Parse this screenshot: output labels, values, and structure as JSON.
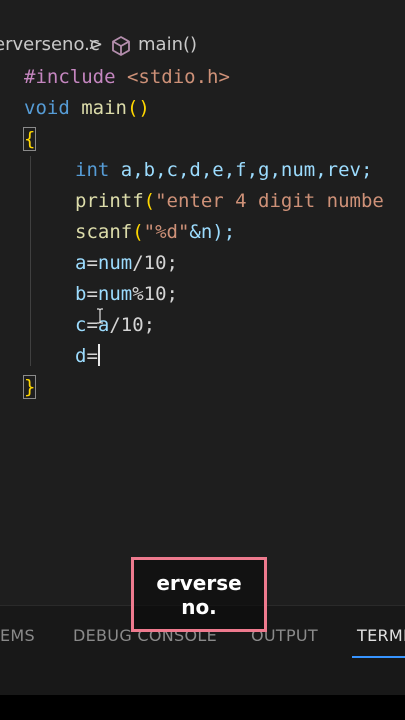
{
  "breadcrumb": {
    "file": "erverseno.c",
    "separator": ">",
    "function": "main()"
  },
  "code_lines": {
    "l1": {
      "directive": "#include",
      "header": "<stdio.h>"
    },
    "l2": {
      "type": "void",
      "name": "main",
      "parens": "()"
    },
    "l3": {
      "brace": "{"
    },
    "l4": {
      "type": "int",
      "vars": "a,b,c,d,e,f,g,num,rev;"
    },
    "l5": {
      "fn": "printf",
      "open": "(",
      "str": "\"enter 4 digit numbe"
    },
    "l6": {
      "fn": "scanf",
      "open": "(",
      "str": "\"%d\"",
      "rest": "&n);"
    },
    "l7": {
      "var": "a",
      "eq": "=",
      "rhs_var": "num",
      "rest": "/10;"
    },
    "l8": {
      "var": "b",
      "eq": "=",
      "rhs_var": "num",
      "rest": "%10;"
    },
    "l9": {
      "var": "c",
      "eq": "=",
      "rhs_var": "a",
      "rest": "/10;"
    },
    "l10": {
      "var": "d",
      "eq": "="
    },
    "l11": {
      "brace": "}"
    }
  },
  "panel_tabs": {
    "problems": "EMS",
    "debug_console": "DEBUG CONSOLE",
    "output": "OUTPUT",
    "terminal": "TERMI"
  },
  "caption": {
    "line1": "erverse",
    "line2": "no."
  },
  "colors": {
    "editor_bg": "#1e1e1e",
    "keyword": "#569cd6",
    "preprocessor": "#c586c0",
    "function": "#dcdcaa",
    "string": "#ce9178",
    "variable": "#9cdcfe",
    "brace": "#ffd700",
    "caption_border": "#ee7a8e",
    "active_tab_underline": "#3794ff"
  },
  "icons": {
    "breadcrumb_symbol": "cube-icon"
  }
}
